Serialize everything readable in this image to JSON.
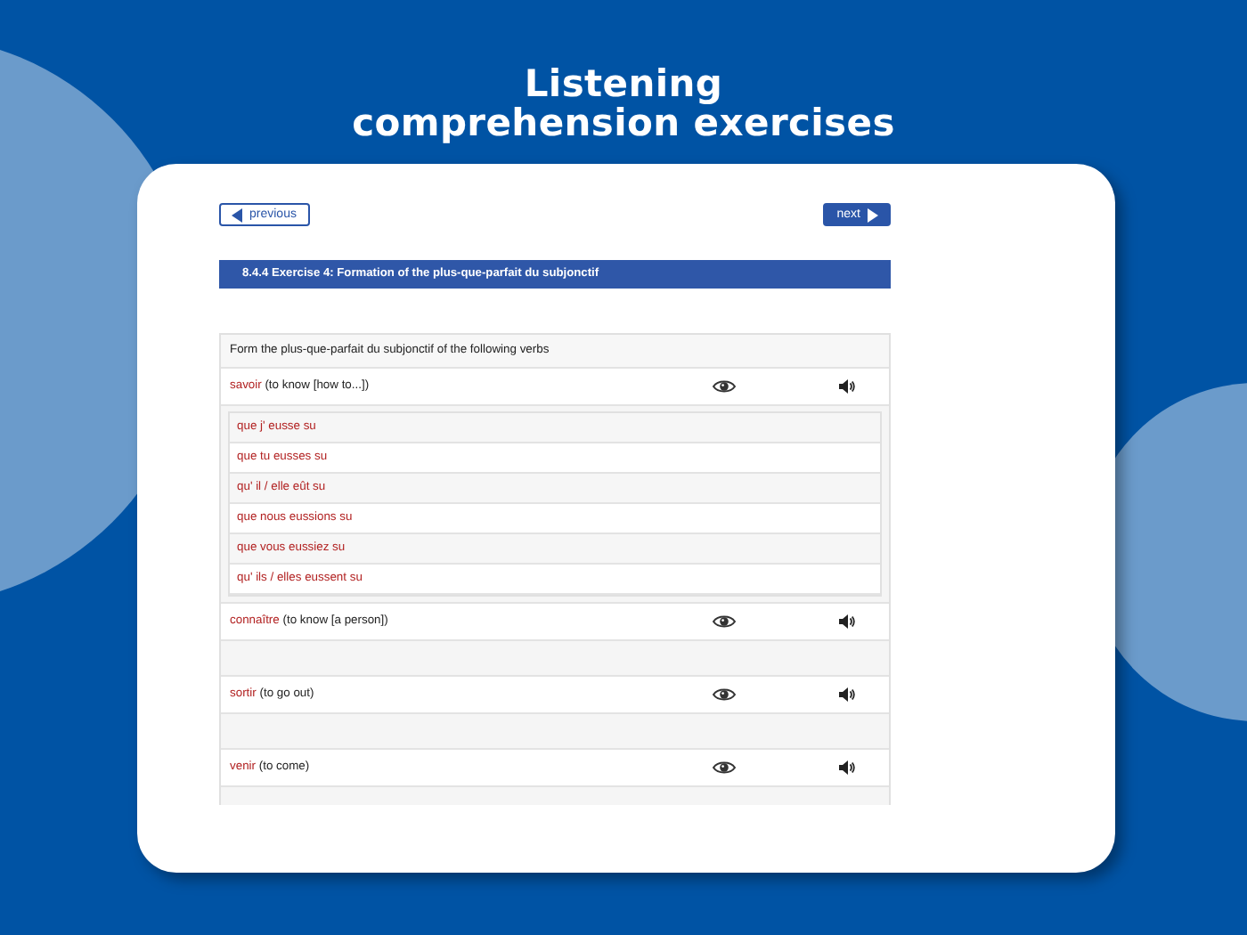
{
  "page_title": {
    "line_1": "Listening",
    "line_2": "comprehension exercises"
  },
  "nav": {
    "previous": "previous",
    "next": "next"
  },
  "exercise_title": "8.4.4 Exercise 4: Formation of the plus-que-parfait du subjonctif",
  "instruction": "Form the plus-que-parfait du subjonctif of the following verbs",
  "verbs": [
    {
      "verb": "savoir",
      "gloss": "(to know [how to...])",
      "expanded": true,
      "forms": [
        "que j' eusse su",
        "que tu eusses su",
        "qu' il / elle eût su",
        "que nous eussions su",
        "que vous eussiez su",
        "qu' ils / elles eussent su"
      ]
    },
    {
      "verb": "connaître",
      "gloss": "(to know [a person])",
      "expanded": false
    },
    {
      "verb": "sortir",
      "gloss": "(to go out)",
      "expanded": false
    },
    {
      "verb": "venir",
      "gloss": "(to come)",
      "expanded": false
    }
  ]
}
